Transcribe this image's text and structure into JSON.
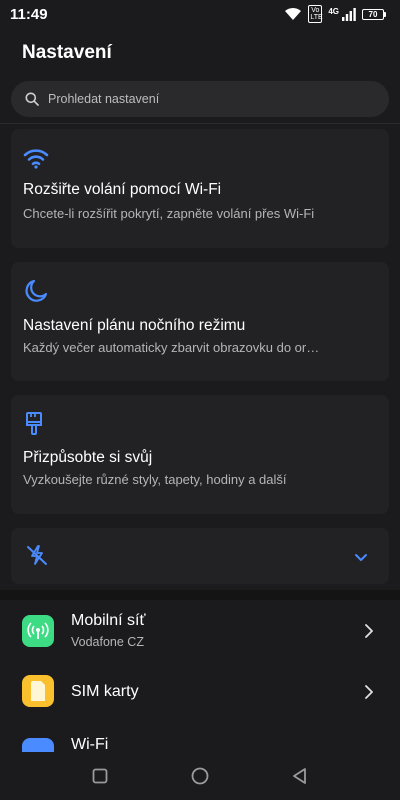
{
  "status_bar": {
    "time": "11:49",
    "volte_top": "Vo",
    "volte_bottom": "LTE",
    "network_type": "4G",
    "battery": "70"
  },
  "header": {
    "title": "Nastavení"
  },
  "search": {
    "placeholder": "Prohledat nastavení"
  },
  "suggestions": [
    {
      "icon": "wifi-icon",
      "title": "Rozšiřte volání pomocí Wi-Fi",
      "subtitle": "Chcete-li rozšířit pokrytí, zapněte volání přes Wi-Fi"
    },
    {
      "icon": "moon-icon",
      "title": "Nastavení plánu nočního režimu",
      "subtitle": "Každý večer automaticky zbarvit obrazovku do or…"
    },
    {
      "icon": "paintbrush-icon",
      "title": "Přizpůsobte si svůj",
      "subtitle": "Vyzkoušejte různé styly, tapety, hodiny a další"
    }
  ],
  "collapsed_card": {
    "icon": "data-off-icon",
    "expand_icon": "chevron-down-icon"
  },
  "settings_list": [
    {
      "icon": "antenna-icon",
      "icon_color": "#3ddc84",
      "title": "Mobilní síť",
      "subtitle": "Vodafone CZ"
    },
    {
      "icon": "sim-card-icon",
      "icon_color": "#fbc02d",
      "title": "SIM karty",
      "subtitle": ""
    },
    {
      "icon": "wifi-icon",
      "icon_color": "#4a8cff",
      "title": "Wi-Fi",
      "subtitle": ""
    }
  ],
  "nav": {
    "recent": "square-icon",
    "home": "circle-icon",
    "back": "triangle-back-icon"
  },
  "colors": {
    "accent": "#4a8cff",
    "background": "#1b1b1d",
    "card": "#222224",
    "search": "#2a2a2c"
  }
}
